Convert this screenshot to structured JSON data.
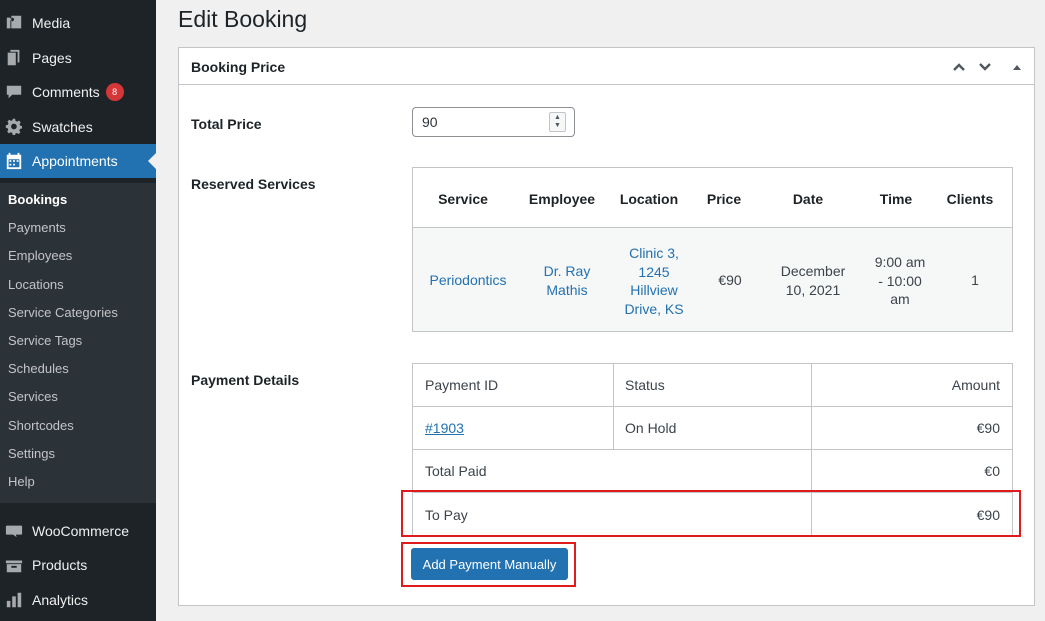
{
  "sidebar": {
    "items": [
      {
        "label": "Media",
        "icon": "media-icon"
      },
      {
        "label": "Pages",
        "icon": "pages-icon"
      },
      {
        "label": "Comments",
        "icon": "comments-icon",
        "badge": "8"
      },
      {
        "label": "Swatches",
        "icon": "gear-icon"
      },
      {
        "label": "Appointments",
        "icon": "calendar-icon"
      }
    ],
    "submenu": [
      "Bookings",
      "Payments",
      "Employees",
      "Locations",
      "Service Categories",
      "Service Tags",
      "Schedules",
      "Services",
      "Shortcodes",
      "Settings",
      "Help"
    ],
    "bottom_items": [
      {
        "label": "WooCommerce",
        "icon": "woocommerce-icon"
      },
      {
        "label": "Products",
        "icon": "products-icon"
      },
      {
        "label": "Analytics",
        "icon": "analytics-icon"
      }
    ]
  },
  "page": {
    "title": "Edit Booking"
  },
  "panel": {
    "title": "Booking Price",
    "total_price_label": "Total Price",
    "total_price_value": "90",
    "reserved_label": "Reserved Services",
    "payment_label": "Payment Details"
  },
  "services_table": {
    "headers": [
      "Service",
      "Employee",
      "Location",
      "Price",
      "Date",
      "Time",
      "Clients"
    ],
    "row": {
      "service": "Periodontics",
      "employee": [
        "Dr. Ray",
        "Mathis"
      ],
      "location": [
        "Clinic 3,",
        "1245",
        "Hillview",
        "Drive, KS"
      ],
      "price": "€90",
      "date": [
        "December",
        "10, 2021"
      ],
      "time": [
        "9:00 am",
        "- 10:00",
        "am"
      ],
      "clients": "1"
    }
  },
  "payments_table": {
    "headers": {
      "id": "Payment ID",
      "status": "Status",
      "amount": "Amount"
    },
    "row": {
      "id": "#1903",
      "status": "On Hold",
      "amount": "€90"
    },
    "total_paid": {
      "label": "Total Paid",
      "amount": "€0"
    },
    "to_pay": {
      "label": "To Pay",
      "amount": "€90"
    }
  },
  "buttons": {
    "add_payment": "Add Payment Manually"
  },
  "colors": {
    "accent": "#2271b1",
    "highlight": "#e01b1b",
    "badge": "#d63638"
  }
}
